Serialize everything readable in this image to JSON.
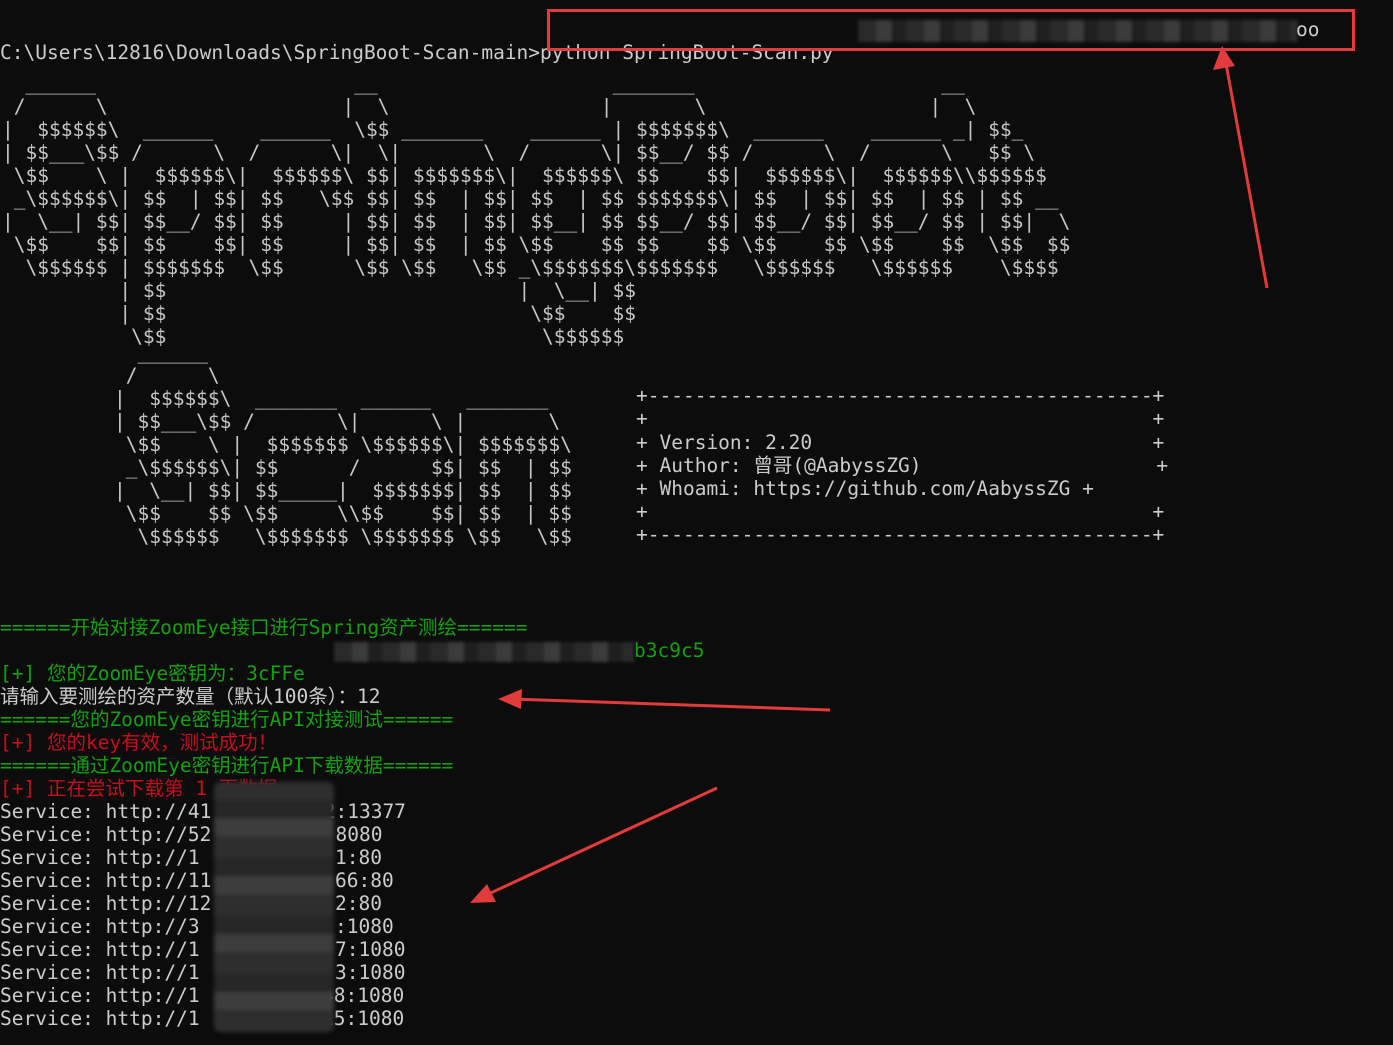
{
  "prompt": "C:\\Users\\12816\\Downloads\\SpringBoot-Scan-main>",
  "command": "python SpringBoot-Scan.py",
  "command_tail": "oo",
  "banner_line1": "  ______                      __                    _______                     __   \n /      \\                    |  \\                  |       \\                   |  \\  \n|  $$$$$$\\  ______    ______  \\$$ _______    ______ | $$$$$$$\\  ______    ______ _| $$_  \n| $$___\\$$ /      \\  /      \\|  \\|       \\  /      \\| $$__/ $$ /      \\  /      \\   $$ \\ \n \\$$    \\ |  $$$$$$\\|  $$$$$$\\ $$| $$$$$$$\\|  $$$$$$\\ $$    $$|  $$$$$$\\|  $$$$$$\\\\$$$$$$ \n _\\$$$$$$\\| $$  | $$| $$   \\$$ $$| $$  | $$| $$  | $$ $$$$$$$\\| $$  | $$| $$  | $$ | $$ __ \n|  \\__| $$| $$__/ $$| $$     | $$| $$  | $$| $$__| $$ $$__/ $$| $$__/ $$| $$__/ $$ | $$|  \\\n \\$$    $$| $$    $$| $$     | $$| $$  | $$ \\$$    $$ $$    $$ \\$$    $$ \\$$    $$  \\$$  $$\n  \\$$$$$$ | $$$$$$$  \\$$      \\$$ \\$$   \\$$ _\\$$$$$$$\\$$$$$$$   \\$$$$$$   \\$$$$$$    \\$$$$ \n          | $$                              |  \\__| $$                                   \n          | $$                               \\$$    $$                                   \n           \\$$                                \\$$$$$$                                    ",
  "banner_line2": "  ______                                \n /      \\                               \n|  $$$$$$\\  _______  ______   _______  \n| $$___\\$$ /       \\|      \\ |       \\ \n \\$$    \\ |  $$$$$$$ \\$$$$$$\\| $$$$$$$\\\n _\\$$$$$$\\| $$      /      $$| $$  | $$\n|  \\__| $$| $$_____|  $$$$$$$| $$  | $$\n \\$$    $$ \\$$     \\\\$$    $$| $$  | $$\n  \\$$$$$$   \\$$$$$$$ \\$$$$$$$ \\$$   \\$$",
  "info_box": {
    "border": "+-------------------------------------------+",
    "blank": "+                                           +",
    "version": "+ Version: 2.20                             +",
    "author": "+ Author: 曾哥(@AabyssZG)                    +",
    "whoami": "+ Whoami: https://github.com/AabyssZG +"
  },
  "output": {
    "zoomeye_start": "======开始对接ZoomEye接口进行Spring资产测绘======",
    "key_prefix": "[+] 您的ZoomEye密钥为：3cFFe",
    "key_suffix": "b3c9c5",
    "input_prompt": "请输入要测绘的资产数量（默认100条）：12",
    "api_test": "======您的ZoomEye密钥进行API对接测试======",
    "key_valid": "[+] 您的key有效，测试成功！",
    "download": "======通过ZoomEye密钥进行API下载数据======",
    "trying_page": "[+] 正在尝试下载第 1 页数据"
  },
  "services": [
    {
      "prefix": "Service: http://41",
      "suffix": "52:13377"
    },
    {
      "prefix": "Service: http://52",
      "suffix": "3:8080"
    },
    {
      "prefix": "Service: http://1",
      "suffix": "1:80"
    },
    {
      "prefix": "Service: http://11",
      "suffix": "66:80"
    },
    {
      "prefix": "Service: http://12",
      "suffix": "2:80"
    },
    {
      "prefix": "Service: http://3",
      "suffix": ":1080"
    },
    {
      "prefix": "Service: http://1",
      "suffix": "7:1080"
    },
    {
      "prefix": "Service: http://1",
      "suffix": "3:1080"
    },
    {
      "prefix": "Service: http://1",
      "suffix": "48:1080"
    },
    {
      "prefix": "Service: http://1",
      "suffix": "15:1080"
    }
  ],
  "colors": {
    "background": "#0c0c0c",
    "text": "#cccccc",
    "green": "#13a10e",
    "red": "#c50f1f",
    "annotation": "#e23b3b"
  }
}
